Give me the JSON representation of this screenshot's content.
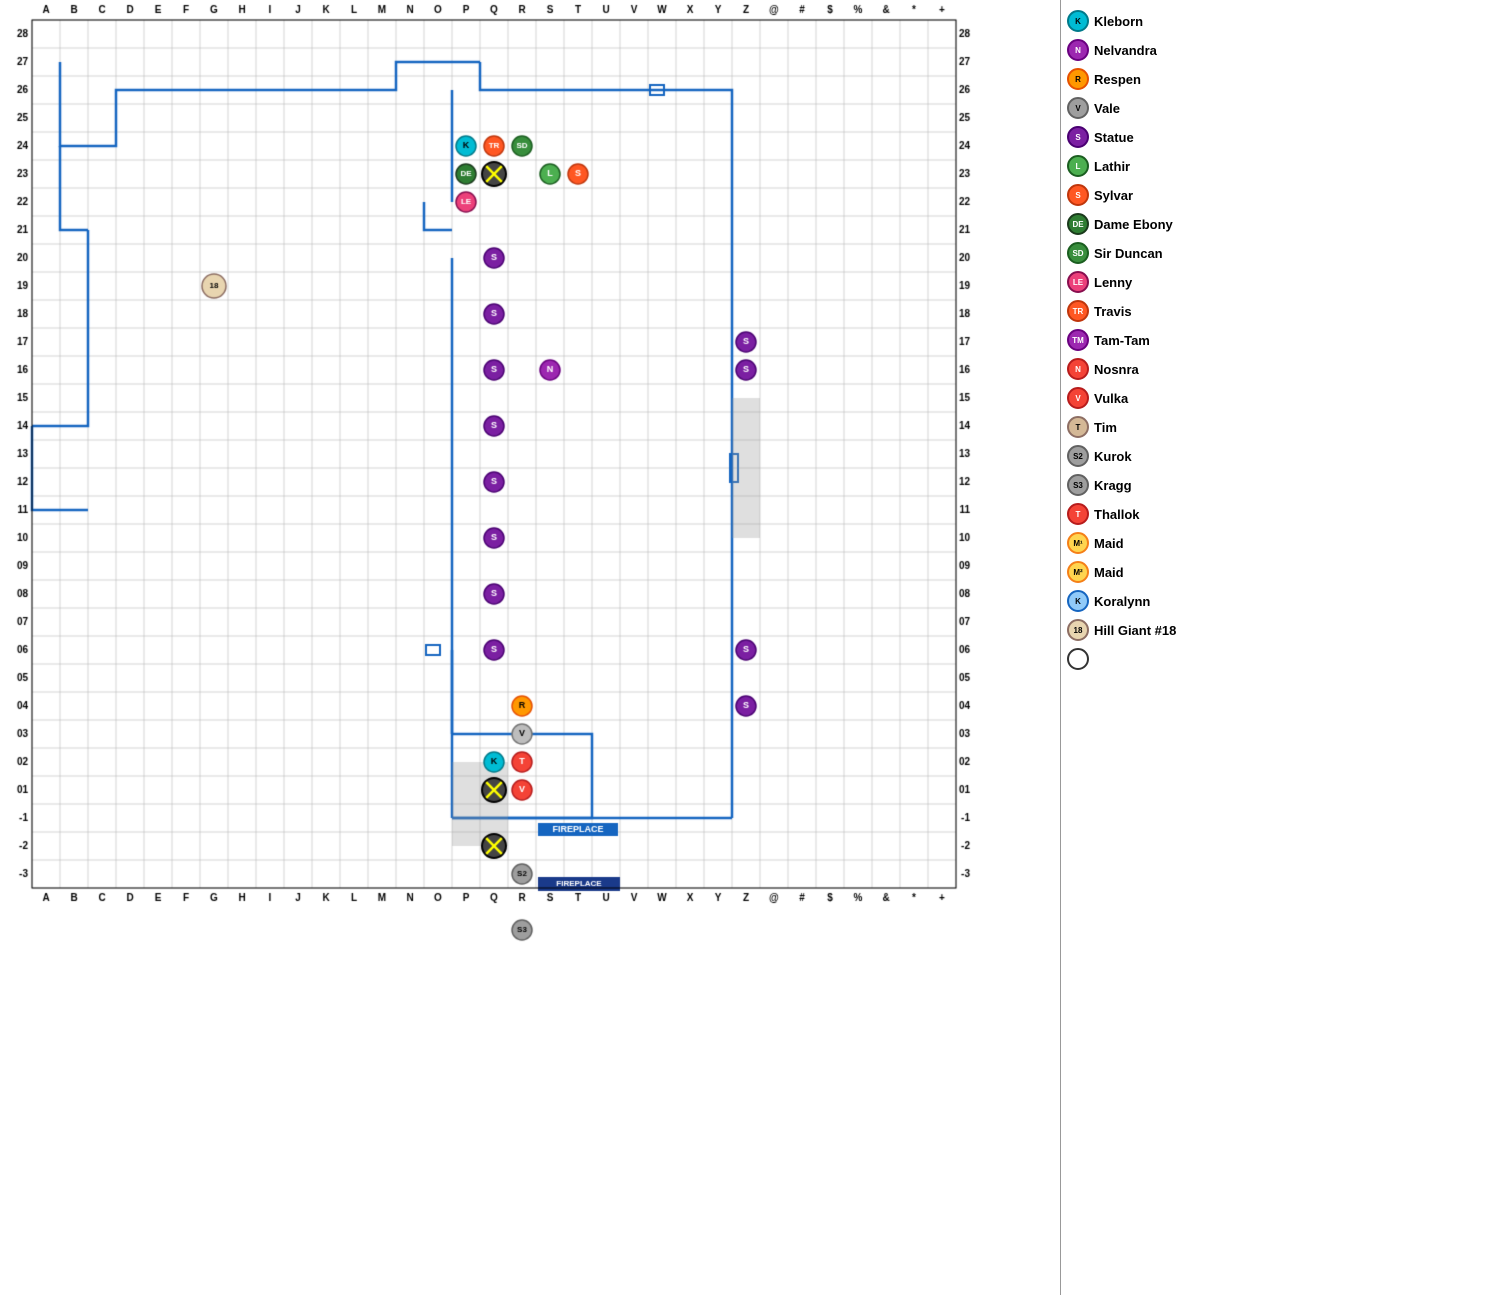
{
  "grid": {
    "cols": [
      "A",
      "B",
      "C",
      "D",
      "E",
      "F",
      "G",
      "H",
      "I",
      "J",
      "K",
      "L",
      "M",
      "N",
      "O",
      "P",
      "Q",
      "R",
      "S",
      "T",
      "U",
      "V",
      "W",
      "X",
      "Y",
      "Z",
      "@",
      "#",
      "$",
      "%",
      "&",
      "*",
      "+"
    ],
    "rows": [
      "28",
      "27",
      "26",
      "25",
      "24",
      "23",
      "22",
      "21",
      "20",
      "19",
      "18",
      "17",
      "16",
      "15",
      "14",
      "13",
      "12",
      "11",
      "10",
      "09",
      "08",
      "07",
      "06",
      "05",
      "04",
      "03",
      "02",
      "01",
      "-1",
      "-2",
      "-3"
    ],
    "cell_size": 28,
    "left_margin": 30,
    "top_margin": 20
  },
  "legend": [
    {
      "id": "kleborn",
      "symbol": "K",
      "color": "cyan",
      "name": "Kleborn"
    },
    {
      "id": "nelvandra",
      "symbol": "N",
      "color": "purple",
      "name": "Nelvandra"
    },
    {
      "id": "respen",
      "symbol": "R",
      "color": "orange",
      "name": "Respen"
    },
    {
      "id": "vale",
      "symbol": "V",
      "color": "gray",
      "name": "Vale"
    },
    {
      "id": "statue",
      "symbol": "S",
      "color": "darkpurple",
      "name": "Statue"
    },
    {
      "id": "lathir",
      "symbol": "L",
      "color": "green",
      "name": "Lathir"
    },
    {
      "id": "sylvar",
      "symbol": "S",
      "color": "sylvar",
      "name": "Sylvar"
    },
    {
      "id": "dameebony",
      "symbol": "DE",
      "color": "dameebony",
      "name": "Dame Ebony"
    },
    {
      "id": "sirduncan",
      "symbol": "SD",
      "color": "sirduncan",
      "name": "Sir Duncan"
    },
    {
      "id": "lenny",
      "symbol": "LE",
      "color": "lenny",
      "name": "Lenny"
    },
    {
      "id": "travis",
      "symbol": "TR",
      "color": "travis",
      "name": "Travis"
    },
    {
      "id": "tamtam",
      "symbol": "TM",
      "color": "tamtam",
      "name": "Tam-Tam"
    },
    {
      "id": "nosnra",
      "symbol": "N",
      "color": "nosnra",
      "name": "Nosnra"
    },
    {
      "id": "vulka",
      "symbol": "V",
      "color": "vulka",
      "name": "Vulka"
    },
    {
      "id": "tim",
      "symbol": "T",
      "color": "tim",
      "name": "Tim"
    },
    {
      "id": "kurok",
      "symbol": "S2",
      "color": "kurok",
      "name": "Kurok"
    },
    {
      "id": "kragg",
      "symbol": "S3",
      "color": "kragg",
      "name": "Kragg"
    },
    {
      "id": "thallok",
      "symbol": "T",
      "color": "thallok",
      "name": "Thallok"
    },
    {
      "id": "maid1",
      "symbol": "M¹",
      "color": "maid",
      "name": "Maid"
    },
    {
      "id": "maid2",
      "symbol": "M²",
      "color": "maid",
      "name": "Maid"
    },
    {
      "id": "koralynn",
      "symbol": "K",
      "color": "koralynn",
      "name": "Koralynn"
    },
    {
      "id": "hillgiant",
      "symbol": "18",
      "color": "hillgiant",
      "name": "Hill Giant #18"
    }
  ],
  "tokens": [
    {
      "id": "kleborn-grid",
      "symbol": "K",
      "col": 15,
      "row": 4,
      "color": "cyan",
      "size": "small"
    },
    {
      "id": "travis-grid",
      "symbol": "TR",
      "col": 16,
      "row": 4,
      "color": "travis",
      "size": "small"
    },
    {
      "id": "sirduncan-grid",
      "symbol": "SD",
      "col": 17,
      "row": 4,
      "color": "sirduncan",
      "size": "small"
    },
    {
      "id": "dameebony-grid",
      "symbol": "DE",
      "col": 15,
      "row": 5,
      "color": "dameebony",
      "size": "small"
    },
    {
      "id": "x1",
      "symbol": "X",
      "col": 16,
      "row": 5,
      "color": "x",
      "size": "large"
    },
    {
      "id": "lenny-grid",
      "symbol": "LE",
      "col": 15,
      "row": 6,
      "color": "lenny",
      "size": "small"
    },
    {
      "id": "lathir-grid",
      "symbol": "L",
      "col": 19,
      "row": 5,
      "color": "green",
      "size": "small"
    },
    {
      "id": "sylvar-grid",
      "symbol": "S",
      "col": 20,
      "row": 5,
      "color": "sylvar",
      "size": "small"
    },
    {
      "id": "hillgiant-grid",
      "symbol": "18",
      "col": 7,
      "row": 9,
      "color": "hillgiant",
      "size": "large"
    },
    {
      "id": "statue-p20",
      "symbol": "S",
      "col": 16,
      "row": 12,
      "color": "darkpurple",
      "size": "small"
    },
    {
      "id": "nelvandra-grid",
      "symbol": "N",
      "col": 19,
      "row": 12,
      "color": "purple",
      "size": "small"
    },
    {
      "id": "statue-p19",
      "symbol": "S",
      "col": 16,
      "row": 13,
      "color": "darkpurple",
      "size": "small"
    },
    {
      "id": "statue-y21",
      "symbol": "S",
      "col": 25,
      "row": 11,
      "color": "darkpurple",
      "size": "small"
    },
    {
      "id": "statue-y20",
      "symbol": "S",
      "col": 25,
      "row": 12,
      "color": "darkpurple",
      "size": "small"
    },
    {
      "id": "statue-p18",
      "symbol": "S",
      "col": 16,
      "row": 14,
      "color": "darkpurple",
      "size": "small"
    },
    {
      "id": "statue-p17",
      "symbol": "S",
      "col": 16,
      "row": 15,
      "color": "darkpurple",
      "size": "small"
    },
    {
      "id": "statue-p16",
      "symbol": "S",
      "col": 16,
      "row": 16,
      "color": "darkpurple",
      "size": "small"
    },
    {
      "id": "statue-p15",
      "symbol": "S",
      "col": 16,
      "row": 17,
      "color": "darkpurple",
      "size": "small"
    },
    {
      "id": "statue-p14",
      "symbol": "S",
      "col": 16,
      "row": 18,
      "color": "darkpurple",
      "size": "small"
    },
    {
      "id": "statue-p13",
      "symbol": "S",
      "col": 16,
      "row": 19,
      "color": "darkpurple",
      "size": "small"
    },
    {
      "id": "statue-p12",
      "symbol": "S",
      "col": 16,
      "row": 20,
      "color": "darkpurple",
      "size": "small"
    },
    {
      "id": "statue-p10",
      "symbol": "S",
      "col": 16,
      "row": 22,
      "color": "darkpurple",
      "size": "small"
    },
    {
      "id": "statue-y10",
      "symbol": "S",
      "col": 25,
      "row": 22,
      "color": "darkpurple",
      "size": "small"
    },
    {
      "id": "respen-grid",
      "symbol": "R",
      "col": 17,
      "row": 24,
      "color": "orange",
      "size": "small"
    },
    {
      "id": "vale-grid",
      "symbol": "V",
      "col": 17,
      "row": 25,
      "color": "gray",
      "size": "small"
    },
    {
      "id": "kleborn-grid2",
      "symbol": "K",
      "col": 16,
      "row": 26,
      "color": "cyan",
      "size": "small"
    },
    {
      "id": "thallok-grid",
      "symbol": "T",
      "col": 17,
      "row": 26,
      "color": "thallok",
      "size": "small"
    },
    {
      "id": "x2",
      "symbol": "X",
      "col": 16,
      "row": 27,
      "color": "x",
      "size": "large"
    },
    {
      "id": "vulka-grid",
      "symbol": "V",
      "col": 17,
      "row": 27,
      "color": "vulka",
      "size": "small"
    },
    {
      "id": "x3",
      "symbol": "X",
      "col": 16,
      "row": 29,
      "color": "x",
      "size": "large"
    },
    {
      "id": "kurok-grid",
      "symbol": "S2",
      "col": 17,
      "row": 30,
      "color": "kurok",
      "size": "small"
    },
    {
      "id": "kragg-grid",
      "symbol": "S3",
      "col": 17,
      "row": 32,
      "color": "kragg",
      "size": "small"
    },
    {
      "id": "statue-y8",
      "symbol": "S",
      "col": 25,
      "row": 24,
      "color": "darkpurple",
      "size": "small"
    }
  ],
  "labels": {
    "fireplace": "FIREPLACE"
  }
}
